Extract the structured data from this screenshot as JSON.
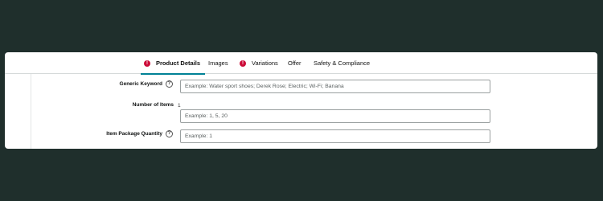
{
  "tabs": [
    {
      "label": "Product Details",
      "error": true,
      "active": true
    },
    {
      "label": "Images",
      "error": false
    },
    {
      "label": "Variations",
      "error": true
    },
    {
      "label": "Offer",
      "error": false
    },
    {
      "label": "Safety & Compliance",
      "error": false
    }
  ],
  "error_glyph": "!",
  "help_glyph": "?",
  "fields": {
    "generic_keyword": {
      "label": "Generic Keyword",
      "placeholder": "Example: Water sport shoes; Derek Rose; Electric; Wi-Fi; Banana",
      "value": ""
    },
    "number_of_items": {
      "label": "Number of Items",
      "count_text": "1",
      "placeholder": "Example: 1, 5, 20",
      "value": ""
    },
    "item_package_quantity": {
      "label": "Item Package Quantity",
      "placeholder": "Example: 1",
      "value": ""
    }
  },
  "colors": {
    "background": "#1f2f2c",
    "accent": "#008296",
    "error": "#cc0c39"
  }
}
